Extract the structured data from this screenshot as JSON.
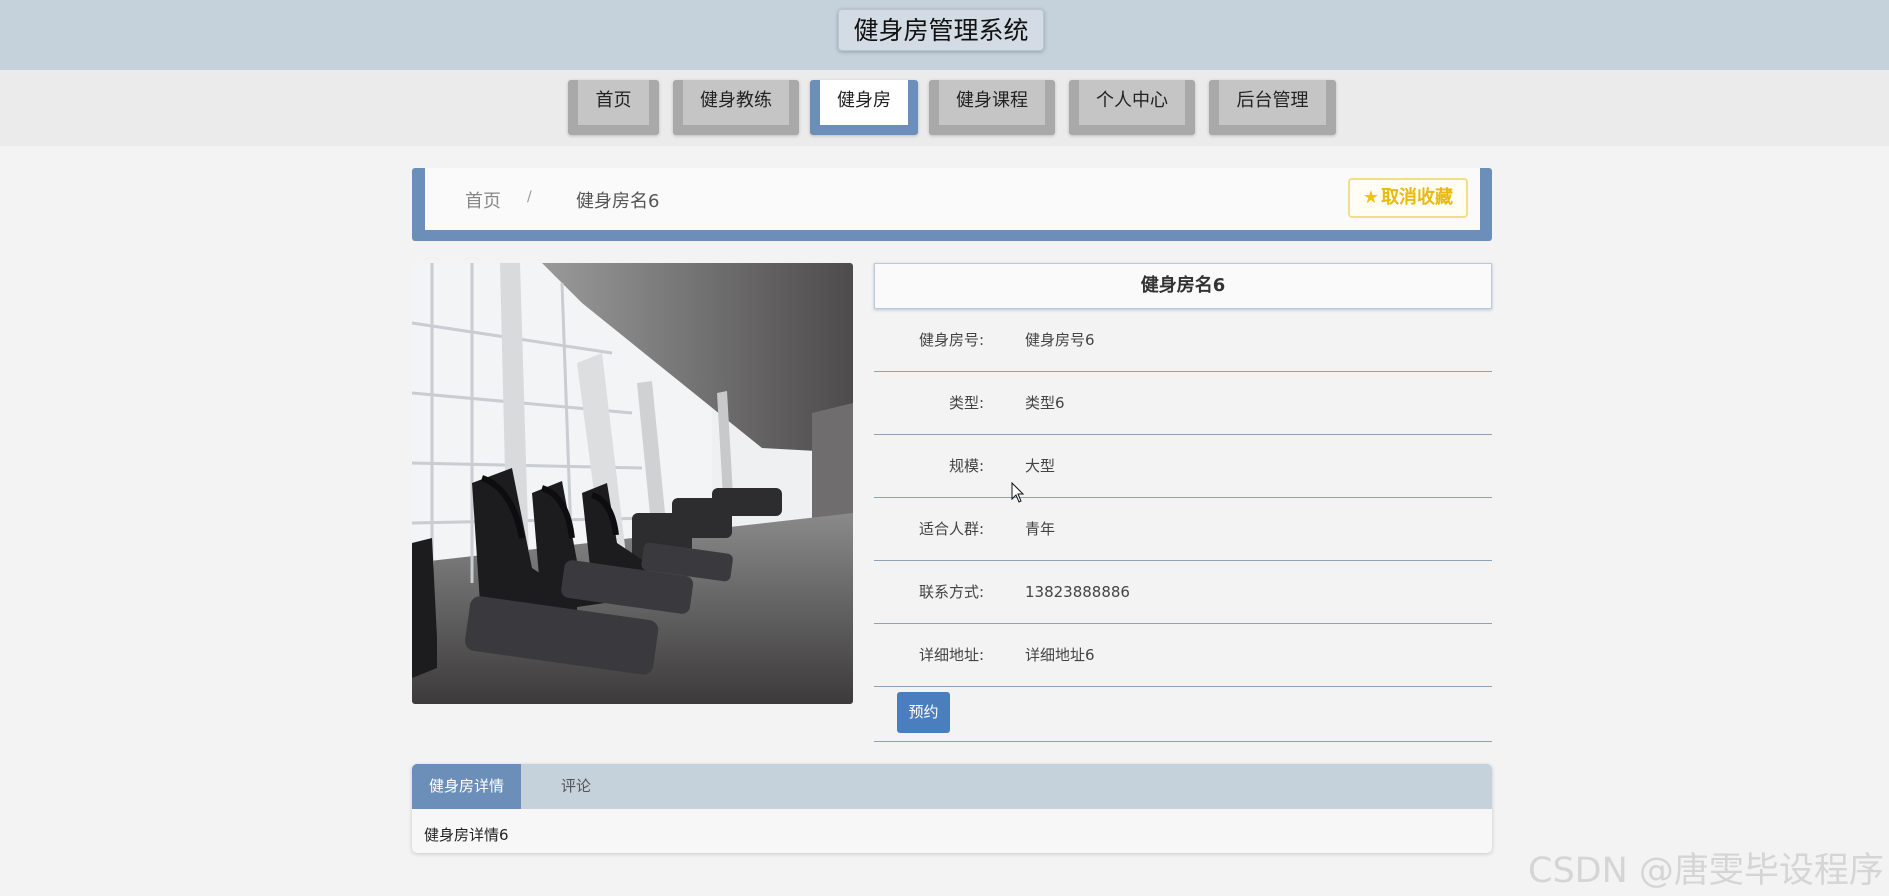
{
  "header": {
    "title": "健身房管理系统"
  },
  "nav": {
    "items": [
      {
        "label": "首页"
      },
      {
        "label": "健身教练"
      },
      {
        "label": "健身房"
      },
      {
        "label": "健身课程"
      },
      {
        "label": "个人中心"
      },
      {
        "label": "后台管理"
      }
    ],
    "active": "健身房"
  },
  "breadcrumb": {
    "home": "首页",
    "separator": "/",
    "current": "健身房名6"
  },
  "favorite": {
    "label": "取消收藏",
    "icon": "star-icon",
    "color": "#e9b90c"
  },
  "detail": {
    "title": "健身房名6",
    "fields": [
      {
        "label": "健身房号:",
        "value": "健身房号6"
      },
      {
        "label": "类型:",
        "value": "类型6"
      },
      {
        "label": "规模:",
        "value": "大型"
      },
      {
        "label": "适合人群:",
        "value": "青年"
      },
      {
        "label": "联系方式:",
        "value": "13823888886"
      },
      {
        "label": "详细地址:",
        "value": "详细地址6"
      }
    ],
    "book_label": "预约"
  },
  "tabs": {
    "items": [
      {
        "label": "健身房详情"
      },
      {
        "label": "评论"
      }
    ],
    "active": "健身房详情",
    "content": "健身房详情6"
  },
  "watermark": "CSDN @唐雯毕设程序",
  "colors": {
    "accent": "#6b8fb8",
    "header_bg": "#c5d2dc",
    "button": "#4a7ebf"
  }
}
